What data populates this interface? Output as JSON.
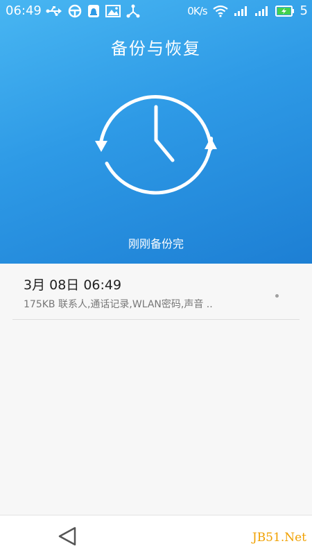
{
  "status_bar": {
    "time": "06:49",
    "icons_left": [
      "usb-icon",
      "steering-wheel-icon",
      "notification-icon",
      "gallery-icon",
      "share-icon"
    ],
    "network_speed": "0K/s",
    "battery_level": "5",
    "icons_right": [
      "wifi-icon",
      "signal-icon",
      "signal-icon",
      "battery-charging-icon"
    ]
  },
  "header": {
    "title": "备份与恢复"
  },
  "hero": {
    "status_text": "刚刚备份完"
  },
  "backup_list": [
    {
      "date": "3月 08日  06:49",
      "detail": "175KB  联系人,通话记录,WLAN密码,声音 .."
    }
  ],
  "watermark": "JB51.Net",
  "colors": {
    "hero_top": "#48b6f2",
    "hero_bottom": "#1d7fd4",
    "watermark": "#f0a000"
  }
}
